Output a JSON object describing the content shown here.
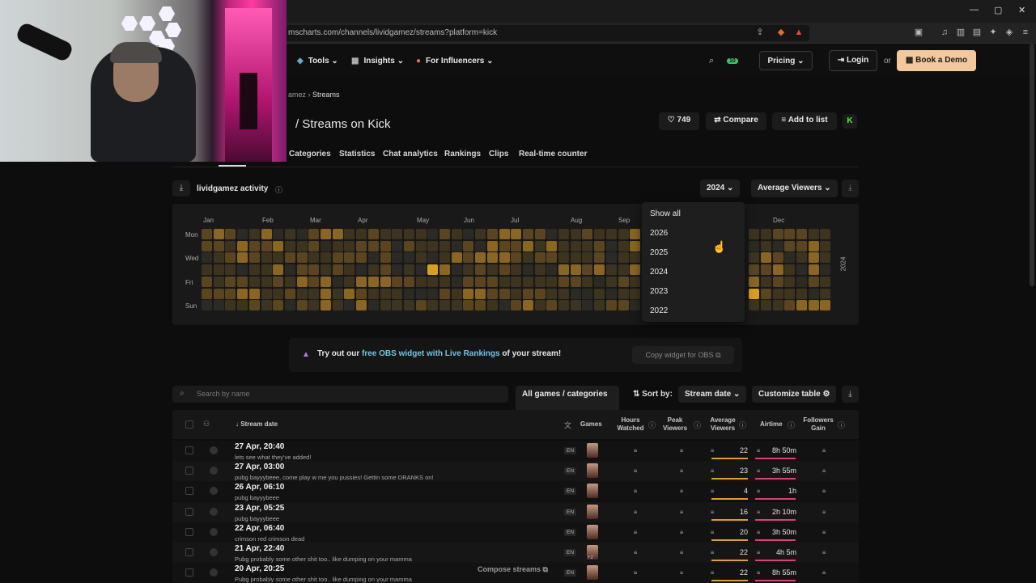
{
  "browser": {
    "url": "mscharts.com/channels/lividgamez/streams?platform=kick",
    "window_controls": [
      "—",
      "▢",
      "✕"
    ]
  },
  "nav": {
    "items": [
      {
        "label": "Tools",
        "icon": "tools-icon"
      },
      {
        "label": "Insights",
        "icon": "insights-icon"
      },
      {
        "label": "For Influencers",
        "icon": "influencers-icon"
      }
    ],
    "notification_count": "10",
    "pricing": "Pricing",
    "login": "Login",
    "or": "or",
    "demo": "Book a Demo"
  },
  "breadcrumb": {
    "part1": "amez",
    "sep": "›",
    "part2": "Streams"
  },
  "page_title": "/ Streams on Kick",
  "actions": {
    "likes": "749",
    "compare": "Compare",
    "add_to_list": "Add to list",
    "kick": "K"
  },
  "tabs": [
    "Categories",
    "Statistics",
    "Chat analytics",
    "Rankings",
    "Clips",
    "Real-time counter"
  ],
  "activity": {
    "title": "lividgamez activity",
    "year": "2024",
    "metric": "Average Viewers",
    "months": [
      "Jan",
      "Feb",
      "Mar",
      "Apr",
      "May",
      "Jun",
      "Jul",
      "Aug",
      "Sep",
      "Dec"
    ],
    "days": [
      "Mon",
      "Wed",
      "Fri",
      "Sun"
    ],
    "year_side_label": "2024"
  },
  "year_dropdown": {
    "options": [
      "Show all",
      "2026",
      "2025",
      "2024",
      "2023",
      "2022"
    ]
  },
  "promo": {
    "prefix": "Try out our ",
    "link": "free OBS widget with Live Rankings",
    "suffix": " of your stream!",
    "button": "Copy widget for OBS"
  },
  "table_controls": {
    "search_placeholder": "Search by name",
    "games_filter": "All games / categories",
    "sort_by_label": "Sort by:",
    "sort_value": "Stream date",
    "customize": "Customize table"
  },
  "columns": {
    "stream_date": "Stream date",
    "games": "Games",
    "hours_watched": "Hours Watched",
    "peak_viewers": "Peak Viewers",
    "avg_viewers": "Average Viewers",
    "airtime": "Airtime",
    "followers_gain": "Followers Gain"
  },
  "rows": [
    {
      "date": "27 Apr, 20:40",
      "title": "lets see what they've added!",
      "lang": "EN",
      "avg": "22",
      "airtime": "8h 50m"
    },
    {
      "date": "27 Apr, 03:00",
      "title": "pubg bayyybeee, come play w me you pussies! Gettin some DRANKS on!",
      "lang": "EN",
      "avg": "23",
      "airtime": "3h 55m"
    },
    {
      "date": "26 Apr, 06:10",
      "title": "pubg bayyybeee",
      "lang": "EN",
      "avg": "4",
      "airtime": "1h"
    },
    {
      "date": "23 Apr, 05:25",
      "title": "pubg bayyybeee",
      "lang": "EN",
      "avg": "16",
      "airtime": "2h 10m"
    },
    {
      "date": "22 Apr, 06:40",
      "title": "crimson red crimson dead",
      "lang": "EN",
      "avg": "20",
      "airtime": "3h 50m"
    },
    {
      "date": "21 Apr, 22:40",
      "title": "Pubg probably some other shit too.. like dumping on your mamma",
      "lang": "EN",
      "avg": "22",
      "airtime": "4h 5m"
    },
    {
      "date": "20 Apr, 20:25",
      "title": "Pubg probably some other shit too.. like dumping on your mamma",
      "lang": "EN",
      "avg": "22",
      "airtime": "8h 55m"
    }
  ],
  "compose_streams": "Compose streams",
  "game_extra": "+2",
  "heatmap_colors": {
    "empty": "#2c2a24",
    "low": "#3d3420",
    "mid": "#5a4520",
    "high": "#8a6620",
    "peak": "#d9a020"
  }
}
